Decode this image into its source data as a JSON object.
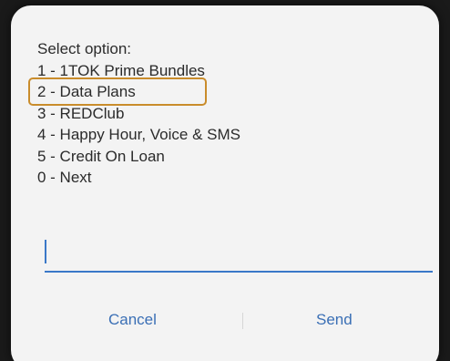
{
  "dialog": {
    "options": [
      "Select option:",
      "1 - 1TOK Prime Bundles",
      "2 - Data Plans",
      "3 - REDClub",
      "4 - Happy Hour, Voice & SMS",
      "5 - Credit On Loan",
      "0 - Next"
    ],
    "highlighted_option_index": 2,
    "input": {
      "value": "",
      "placeholder": ""
    },
    "cancel_label": "Cancel",
    "send_label": "Send"
  },
  "colors": {
    "accent": "#3a78c8",
    "button_text": "#3a6fb5",
    "highlight_border": "#c98c2b",
    "dialog_background": "#f3f3f3"
  }
}
